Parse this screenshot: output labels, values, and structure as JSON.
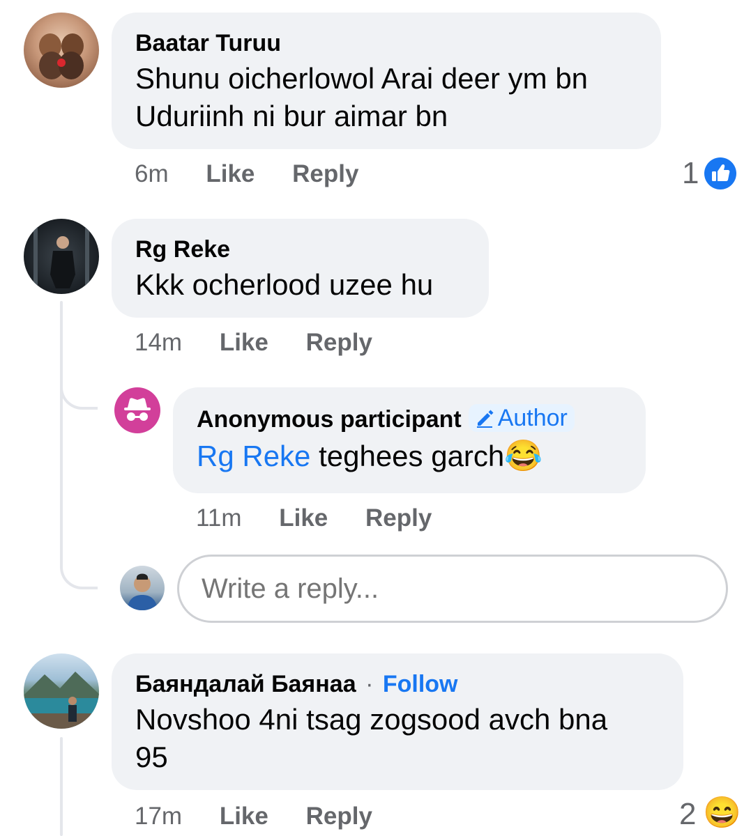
{
  "comments": [
    {
      "author": "Baatar Turuu",
      "text_line1": "Shunu oicherlowol Arai deer ym bn",
      "text_line2": "Uduriinh ni bur aimar bn",
      "time": "6m",
      "like": "Like",
      "reply": "Reply",
      "reactions": {
        "count": "1",
        "icon": "like-reaction-icon",
        "color": "#1877f2"
      }
    },
    {
      "author": "Rg Reke",
      "text": "Kkk ocherlood uzee hu",
      "time": "14m",
      "like": "Like",
      "reply": "Reply",
      "replies": [
        {
          "author": "Anonymous participant",
          "badge": "Author",
          "mention": "Rg Reke",
          "text": " teghees garch",
          "emoji": "😂",
          "avatar_icon": "incognito-icon",
          "avatar_color": "#d23f9a",
          "time": "11m",
          "like": "Like",
          "reply": "Reply"
        }
      ],
      "reply_box": {
        "placeholder": "Write a reply..."
      }
    },
    {
      "author": "Баяндалай Баянаа",
      "separator": "·",
      "follow": "Follow",
      "text_line1": "Novshoo 4ni tsag zogsood avch bna",
      "text_line2": "95",
      "time": "17m",
      "like": "Like",
      "reply": "Reply",
      "reactions": {
        "count": "2",
        "icon": "haha-reaction-icon",
        "emoji": "😄"
      }
    }
  ],
  "colors": {
    "accent": "#1877f2",
    "bubble": "#f0f2f5",
    "muted": "#65676b",
    "thread": "#e4e6eb"
  }
}
